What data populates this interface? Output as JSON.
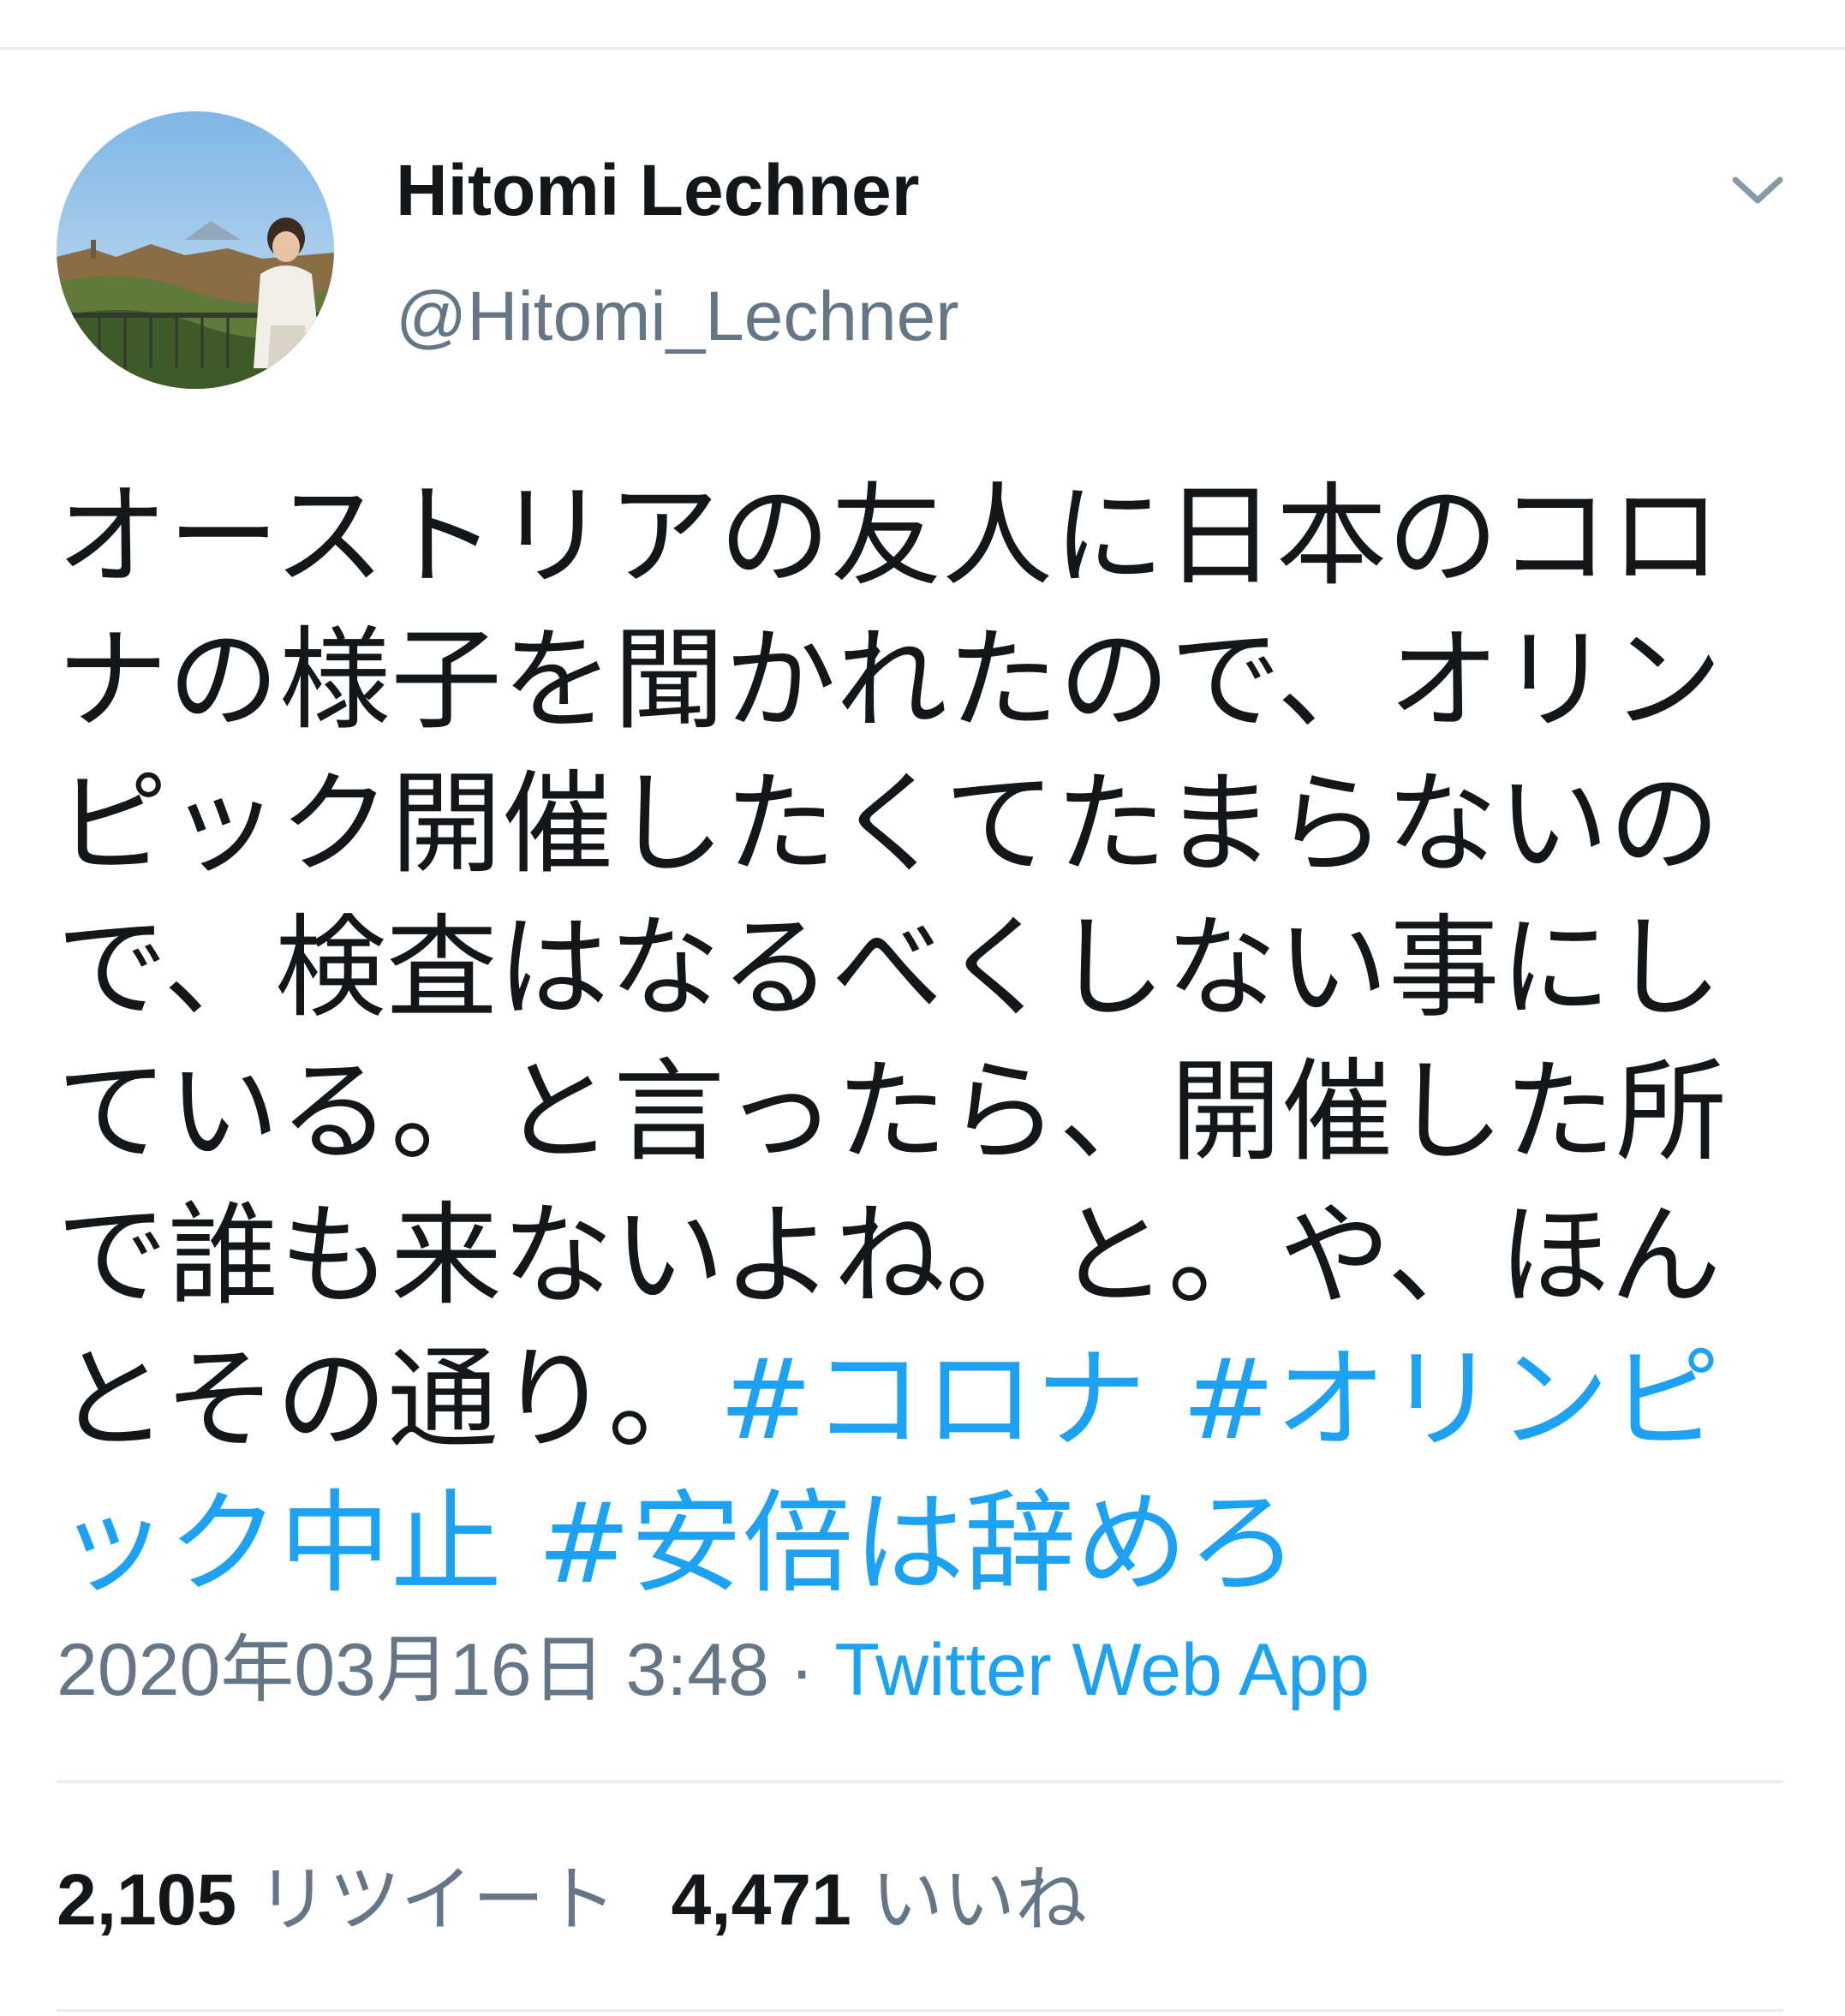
{
  "tweet": {
    "author": {
      "display_name": "Hitomi Lechner",
      "handle": "@Hitomi_Lechner"
    },
    "text_segments": [
      {
        "type": "text",
        "value": "オーストリアの友人に日本のコロナの様子を聞かれたので、オリンピック開催したくてたまらないので、検査はなるべくしない事にしている。と言ったら、開催した所で誰も来ないよね。と。や、ほんとその通り。"
      },
      {
        "type": "hashtag",
        "value": "#コロナ"
      },
      {
        "type": "hashtag",
        "value": "#オリンピック中止"
      },
      {
        "type": "hashtag",
        "value": "#安倍は辞めろ"
      }
    ],
    "timestamp": "2020年03月16日 3:48",
    "separator": "·",
    "source": "Twitter Web App",
    "stats": {
      "retweets_count": "2,105",
      "retweets_label": "リツイート",
      "likes_count": "4,471",
      "likes_label": "いいね"
    }
  },
  "colors": {
    "text": "#14171a",
    "muted": "#657786",
    "accent": "#1da1f2",
    "divider": "#e6ecf0"
  },
  "icons": {
    "menu": "chevron-down-icon",
    "avatar": "profile-photo"
  }
}
